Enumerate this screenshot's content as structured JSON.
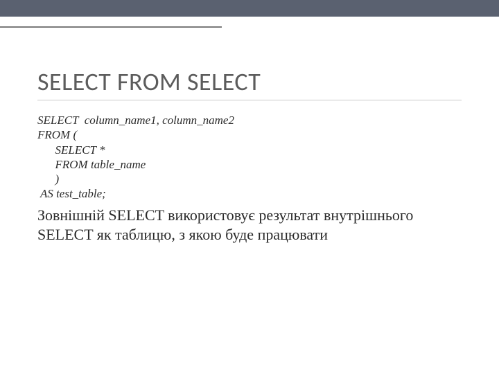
{
  "slide": {
    "title": "SELECT FROM SELECT",
    "code": {
      "line1": "SELECT  column_name1, column_name2",
      "line2": "FROM (",
      "line3": "      SELECT *",
      "line4": "      FROM table_name",
      "line5": "      )",
      "line6": " AS test_table;"
    },
    "description": "Зовнішній SELECT використовує результат внутрішнього SELECT як таблицю, з якою буде працювати"
  }
}
